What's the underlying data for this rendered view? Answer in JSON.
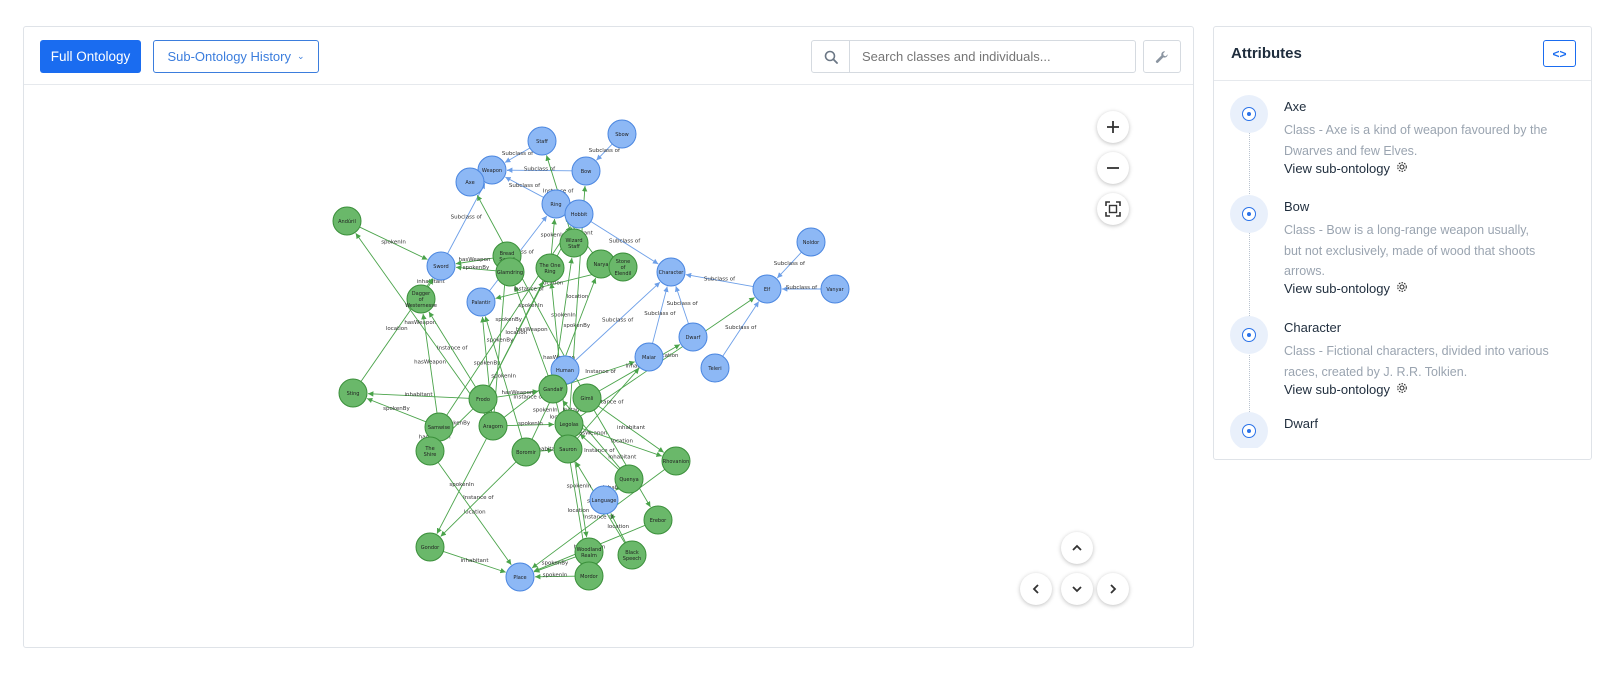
{
  "toolbar": {
    "full_ontology_label": "Full Ontology",
    "sub_history_label": "Sub-Ontology History",
    "search_placeholder": "Search classes and individuals..."
  },
  "colors": {
    "primary": "#1a6cf0",
    "class_node_fill": "#8db8f5",
    "class_node_stroke": "#4a86e0",
    "individual_node_fill": "#6ab86a",
    "individual_node_stroke": "#3a8f3a",
    "class_edge": "#6d9fe8",
    "individual_edge": "#4aa34a"
  },
  "icons": {
    "search": "search-icon",
    "wrench": "wrench-icon",
    "zoom_in": "plus-icon",
    "zoom_out": "minus-icon",
    "fit": "fit-screen-icon",
    "code": "code-icon",
    "pan": [
      "chevron-up-icon",
      "chevron-left-icon",
      "chevron-down-icon",
      "chevron-right-icon"
    ]
  },
  "attributes": {
    "title": "Attributes",
    "items": [
      {
        "name": "Axe",
        "description": "Class - Axe is a kind of weapon favoured by the Dwarves and few Elves.",
        "link": "View sub-ontology"
      },
      {
        "name": "Bow",
        "description": "Class - Bow is a long-range weapon usually, but not exclusively, made of wood that shoots arrows.",
        "link": "View sub-ontology"
      },
      {
        "name": "Character",
        "description": "Class - Fictional characters, divided into various races, created by J. R.R. Tolkien.",
        "link": "View sub-ontology"
      },
      {
        "name": "Dwarf",
        "description": "",
        "link": ""
      }
    ]
  },
  "graph": {
    "nodes": [
      {
        "id": "Staff",
        "type": "class"
      },
      {
        "id": "Sbow",
        "type": "class"
      },
      {
        "id": "Weapon",
        "type": "class"
      },
      {
        "id": "Axe",
        "type": "class"
      },
      {
        "id": "Bow",
        "type": "class"
      },
      {
        "id": "Ring",
        "type": "class"
      },
      {
        "id": "Hobbit",
        "type": "class"
      },
      {
        "id": "Sword",
        "type": "class"
      },
      {
        "id": "Palantir",
        "type": "class"
      },
      {
        "id": "Character",
        "type": "class"
      },
      {
        "id": "Noldor",
        "type": "class"
      },
      {
        "id": "Elf",
        "type": "class"
      },
      {
        "id": "Vanyar",
        "type": "class"
      },
      {
        "id": "Dwarf",
        "type": "class"
      },
      {
        "id": "Maiar",
        "type": "class"
      },
      {
        "id": "Human",
        "type": "class"
      },
      {
        "id": "Teleri",
        "type": "class"
      },
      {
        "id": "Language",
        "type": "class"
      },
      {
        "id": "Place",
        "type": "class"
      },
      {
        "id": "Andúril",
        "type": "individual"
      },
      {
        "id": "Dagger of Westernesse",
        "type": "individual"
      },
      {
        "id": "Sting",
        "type": "individual"
      },
      {
        "id": "Wizard Staff",
        "type": "individual"
      },
      {
        "id": "Bread Sword",
        "type": "individual"
      },
      {
        "id": "Glamdring",
        "type": "individual"
      },
      {
        "id": "The One Ring",
        "type": "individual"
      },
      {
        "id": "Narya",
        "type": "individual"
      },
      {
        "id": "Stone of Elendil",
        "type": "individual"
      },
      {
        "id": "Gandalf",
        "type": "individual"
      },
      {
        "id": "Gimli",
        "type": "individual"
      },
      {
        "id": "Legolas",
        "type": "individual"
      },
      {
        "id": "Sauron",
        "type": "individual"
      },
      {
        "id": "Samwise",
        "type": "individual"
      },
      {
        "id": "The Shire",
        "type": "individual"
      },
      {
        "id": "Boromir",
        "type": "individual"
      },
      {
        "id": "Aragorn",
        "type": "individual"
      },
      {
        "id": "Frodo",
        "type": "individual"
      },
      {
        "id": "Quenya",
        "type": "individual"
      },
      {
        "id": "Rhovanion",
        "type": "individual"
      },
      {
        "id": "Erebor",
        "type": "individual"
      },
      {
        "id": "Black Speech",
        "type": "individual"
      },
      {
        "id": "Woodland Realm",
        "type": "individual"
      },
      {
        "id": "Mordor",
        "type": "individual"
      },
      {
        "id": "Gondor",
        "type": "individual"
      }
    ],
    "edge_labels": [
      "Subclass of",
      "Instance of",
      "hasWeapon",
      "spokenBy",
      "spokenIn",
      "inhabitant",
      "location"
    ]
  }
}
